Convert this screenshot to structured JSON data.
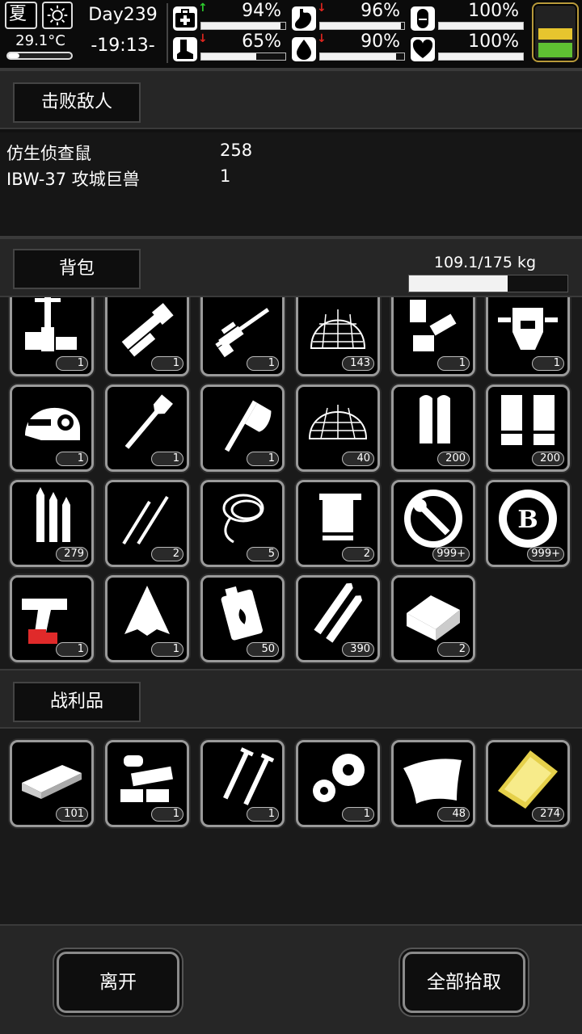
{
  "status": {
    "season": "夏",
    "temperature": "29.1°C",
    "temperature_level": 0.18,
    "day": "Day239",
    "clock": "-19:13-",
    "stats": [
      {
        "icon": "medkit-icon",
        "trend": "up",
        "value": "94%",
        "level": 0.94
      },
      {
        "icon": "stomach-icon",
        "trend": "down",
        "value": "96%",
        "level": 0.96
      },
      {
        "icon": "capsule-icon",
        "trend": "none",
        "value": "100%",
        "level": 1.0
      },
      {
        "icon": "foot-icon",
        "trend": "down",
        "value": "65%",
        "level": 0.65
      },
      {
        "icon": "water-drop-icon",
        "trend": "down",
        "value": "90%",
        "level": 0.9
      },
      {
        "icon": "heart-icon",
        "trend": "none",
        "value": "100%",
        "level": 1.0
      }
    ],
    "colors": {
      "battery_top": "#e7c52e",
      "battery_bottom": "#5fc032",
      "up": "#2dcc2d",
      "down": "#e0261f"
    }
  },
  "defeated": {
    "title": "击败敌人",
    "enemies": [
      {
        "name": "仿生侦查鼠",
        "count": "258"
      },
      {
        "name": "IBW-37 攻城巨兽",
        "count": "1"
      }
    ]
  },
  "backpack": {
    "title": "背包",
    "weight": "109.1/175 kg",
    "weight_level": 0.6234,
    "items": [
      {
        "icon": "turret-icon",
        "qty": "1"
      },
      {
        "icon": "minigun-icon",
        "qty": "1"
      },
      {
        "icon": "sniper-rifle-icon",
        "qty": "1"
      },
      {
        "icon": "net-dome-icon",
        "qty": "143"
      },
      {
        "icon": "robot-parts-icon",
        "qty": "1"
      },
      {
        "icon": "mech-head-icon",
        "qty": "1"
      },
      {
        "icon": "helmet-icon",
        "qty": "1"
      },
      {
        "icon": "shovel-icon",
        "qty": "1"
      },
      {
        "icon": "axe-icon",
        "qty": "1"
      },
      {
        "icon": "net-icon",
        "qty": "40"
      },
      {
        "icon": "bullets-icon",
        "qty": "200"
      },
      {
        "icon": "shotgun-shells-icon",
        "qty": "200"
      },
      {
        "icon": "rifle-bullets-icon",
        "qty": "279"
      },
      {
        "icon": "lockpicks-icon",
        "qty": "2"
      },
      {
        "icon": "rope-icon",
        "qty": "5"
      },
      {
        "icon": "towel-icon",
        "qty": "2"
      },
      {
        "icon": "tool-coin-icon",
        "qty": "999+"
      },
      {
        "icon": "b-token-icon",
        "qty": "999+"
      },
      {
        "icon": "flare-gun-icon",
        "qty": "1"
      },
      {
        "icon": "cloth-scrap-icon",
        "qty": "1"
      },
      {
        "icon": "fuel-canister-icon",
        "qty": "50"
      },
      {
        "icon": "long-rounds-icon",
        "qty": "390"
      },
      {
        "icon": "toolbox-icon",
        "qty": "2"
      }
    ]
  },
  "loot": {
    "title": "战利品",
    "items": [
      {
        "icon": "metal-plate-icon",
        "qty": "101"
      },
      {
        "icon": "machine-parts-icon",
        "qty": "1"
      },
      {
        "icon": "screws-icon",
        "qty": "1"
      },
      {
        "icon": "gears-icon",
        "qty": "1"
      },
      {
        "icon": "glass-sheet-icon",
        "qty": "48"
      },
      {
        "icon": "gold-plate-icon",
        "qty": "274"
      }
    ]
  },
  "actions": {
    "leave": "离开",
    "take_all": "全部拾取"
  }
}
